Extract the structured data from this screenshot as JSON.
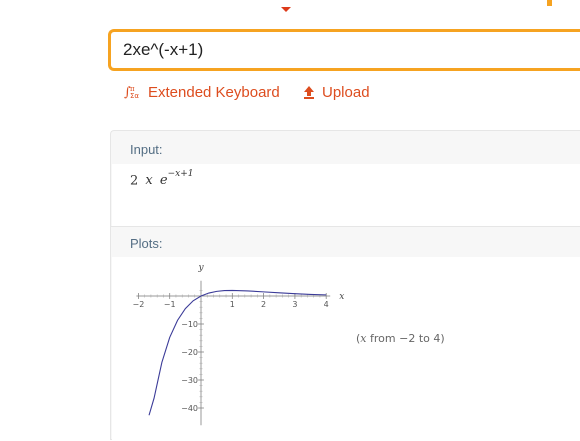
{
  "query": {
    "value": "2xe^(-x+1)"
  },
  "actions": {
    "extended_keyboard_label": "Extended Keyboard",
    "upload_label": "Upload"
  },
  "input_pod": {
    "title": "Input:",
    "expression": {
      "coeff": "2",
      "var": "x",
      "base": "e",
      "exponent": "−x+1"
    }
  },
  "plots_pod": {
    "title": "Plots:",
    "range_caption": {
      "variable": "x",
      "rest": " from −2 to 4)"
    }
  },
  "chart_data": {
    "type": "line",
    "function": "2*x*exp(-x+1)",
    "xlim": [
      -2,
      4
    ],
    "ylim": [
      -44,
      4
    ],
    "xlabel": "x",
    "ylabel": "y",
    "x_ticks": [
      "−2",
      "−1",
      "1",
      "2",
      "3",
      "4"
    ],
    "y_ticks": [
      "−10",
      "−20",
      "−30",
      "−40"
    ],
    "series": [
      {
        "color": "#3b3b98",
        "x": [
          -1.66,
          -1.5,
          -1.25,
          -1.0,
          -0.75,
          -0.5,
          -0.25,
          0.0,
          0.25,
          0.5,
          0.75,
          1.0,
          1.5,
          2.0,
          2.5,
          3.0,
          3.5,
          4.0
        ],
        "y": [
          -42.6,
          -36.5,
          -23.7,
          -14.8,
          -8.7,
          -4.5,
          -1.7,
          0.0,
          1.06,
          1.65,
          1.93,
          2.0,
          1.82,
          1.47,
          1.12,
          0.81,
          0.57,
          0.4
        ]
      }
    ]
  },
  "colors": {
    "accent": "#f6a321",
    "link": "#dd4d1f",
    "pod_title": "#546e84",
    "curve": "#3b3b98"
  }
}
